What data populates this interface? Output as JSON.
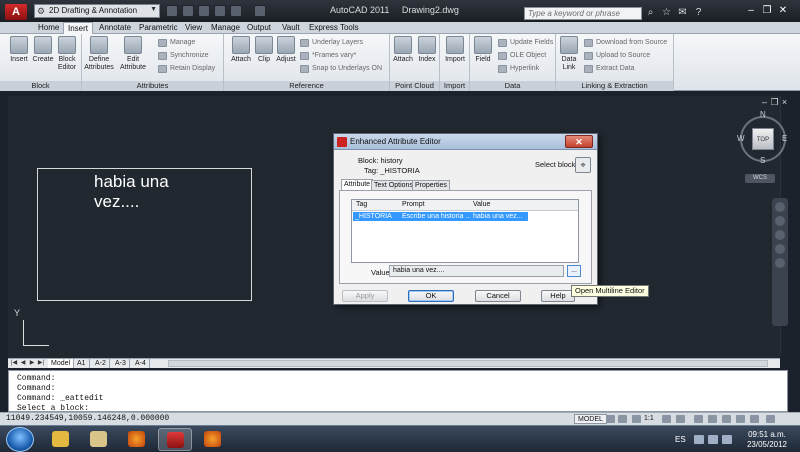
{
  "window": {
    "title": "AutoCAD 2011",
    "document": "Drawing2.dwg",
    "workspace": "2D Drafting & Annotation",
    "search_placeholder": "Type a keyword or phrase"
  },
  "ribbon_tabs": [
    "Home",
    "Insert",
    "Annotate",
    "Parametric",
    "View",
    "Manage",
    "Output",
    "Vault",
    "Express Tools"
  ],
  "ribbon_active_tab": "Insert",
  "panels": {
    "block": {
      "title": "Block",
      "insert": "Insert",
      "create": "Create",
      "block_editor": "Block\nEditor"
    },
    "attributes": {
      "title": "Attributes",
      "define": "Define\nAttributes",
      "edit": "Edit\nAttribute",
      "manage": "Manage",
      "synchronize": "Synchronize",
      "retain_display": "Retain Display"
    },
    "reference": {
      "title": "Reference",
      "attach": "Attach",
      "clip": "Clip",
      "adjust": "Adjust",
      "underlay_layers": "Underlay Layers",
      "frames_vary": "*Frames vary*",
      "snap_underlays": "Snap to Underlays ON"
    },
    "point_cloud": {
      "title": "Point Cloud",
      "attach": "Attach",
      "index": "Index"
    },
    "import": {
      "title": "Import",
      "import": "Import"
    },
    "data": {
      "title": "Data",
      "field": "Field",
      "update_fields": "Update Fields",
      "ole_object": "OLE Object",
      "hyperlink": "Hyperlink"
    },
    "linking": {
      "title": "Linking & Extraction",
      "data_link": "Data\nLink",
      "download": "Download from Source",
      "upload": "Upload to Source",
      "extract": "Extract  Data"
    }
  },
  "drawing": {
    "text_line1": "habia una",
    "text_line2": "vez....",
    "ucs_label": "Y"
  },
  "viewcube": {
    "top": "TOP",
    "north": "N",
    "south": "S",
    "east": "E",
    "west": "W",
    "wcs": "WCS"
  },
  "layout_tabs": [
    "Model",
    "A1",
    "A-2",
    "A-3",
    "A-4"
  ],
  "command_lines": [
    "Command:",
    "Command:",
    "Command: _eattedit",
    "Select a block:"
  ],
  "status": {
    "coordinates": "11049.234549,10059.146248,0.000000",
    "model": "MODEL",
    "scale": "1:1"
  },
  "taskbar": {
    "language": "ES",
    "time": "09:51 a.m.",
    "date": "23/05/2012"
  },
  "dialog": {
    "title": "Enhanced Attribute Editor",
    "block_label": "Block: history",
    "tag_label": "Tag:  _HISTORIA",
    "select_block": "Select block",
    "tabs": [
      "Attribute",
      "Text Options",
      "Properties"
    ],
    "columns": [
      "Tag",
      "Prompt",
      "Value"
    ],
    "row": {
      "tag": "_HISTORIA",
      "prompt": "Escribe una historia ...",
      "value": "habia una vez..."
    },
    "value_label": "Value:",
    "value": "habia una vez....",
    "ellipsis": "...",
    "apply": "Apply",
    "ok": "OK",
    "cancel": "Cancel",
    "help": "Help",
    "tooltip": "Open Multiline Editor"
  }
}
